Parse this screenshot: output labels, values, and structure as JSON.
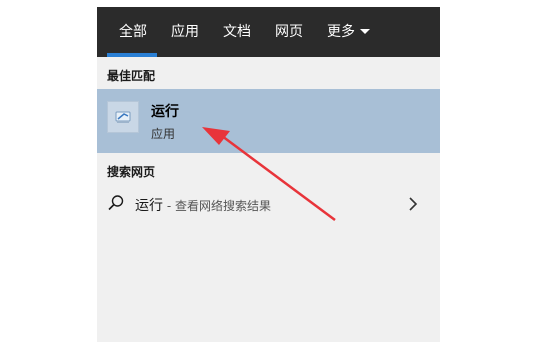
{
  "tabs": [
    {
      "label": "全部",
      "active": true
    },
    {
      "label": "应用",
      "active": false
    },
    {
      "label": "文档",
      "active": false
    },
    {
      "label": "网页",
      "active": false
    },
    {
      "label": "更多",
      "active": false
    }
  ],
  "best_match": {
    "section_title": "最佳匹配",
    "app_name": "运行",
    "app_type": "应用",
    "icon": "run-dialog-icon"
  },
  "web_search": {
    "section_title": "搜索网页",
    "query": "运行",
    "hint": " - 查看网络搜索结果",
    "icon": "search-icon"
  },
  "colors": {
    "tabbar_bg": "#2b2b2b",
    "accent": "#2a7fd4",
    "selected_bg": "#a8bfd6",
    "panel_bg": "#f0f0f0",
    "annotation_arrow": "#e8343a"
  }
}
